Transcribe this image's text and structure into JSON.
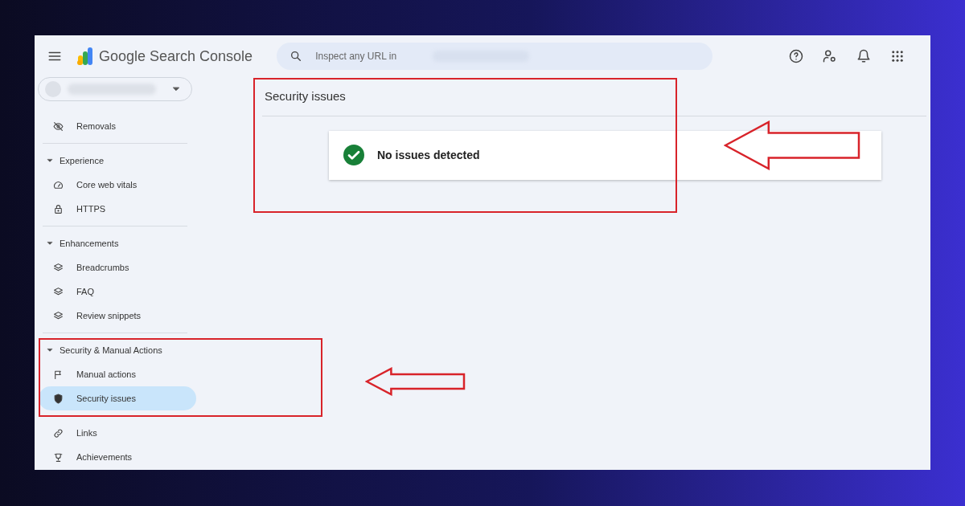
{
  "header": {
    "app_name": "Google Search Console",
    "search": {
      "placeholder": "Inspect any URL in"
    }
  },
  "sidebar": {
    "groups": [
      {
        "items": [
          {
            "label": "Removals",
            "selected": false
          }
        ]
      },
      {
        "title": "Experience",
        "expanded": true,
        "items": [
          {
            "label": "Core web vitals",
            "selected": false
          },
          {
            "label": "HTTPS",
            "selected": false
          }
        ]
      },
      {
        "title": "Enhancements",
        "expanded": true,
        "items": [
          {
            "label": "Breadcrumbs",
            "selected": false
          },
          {
            "label": "FAQ",
            "selected": false
          },
          {
            "label": "Review snippets",
            "selected": false
          }
        ]
      },
      {
        "title": "Security & Manual Actions",
        "expanded": true,
        "items": [
          {
            "label": "Manual actions",
            "selected": false
          },
          {
            "label": "Security issues",
            "selected": true
          }
        ]
      },
      {
        "items": [
          {
            "label": "Links",
            "selected": false
          },
          {
            "label": "Achievements",
            "selected": false
          }
        ]
      }
    ]
  },
  "page": {
    "title": "Security issues",
    "status": {
      "kind": "ok",
      "text": "No issues detected"
    }
  }
}
